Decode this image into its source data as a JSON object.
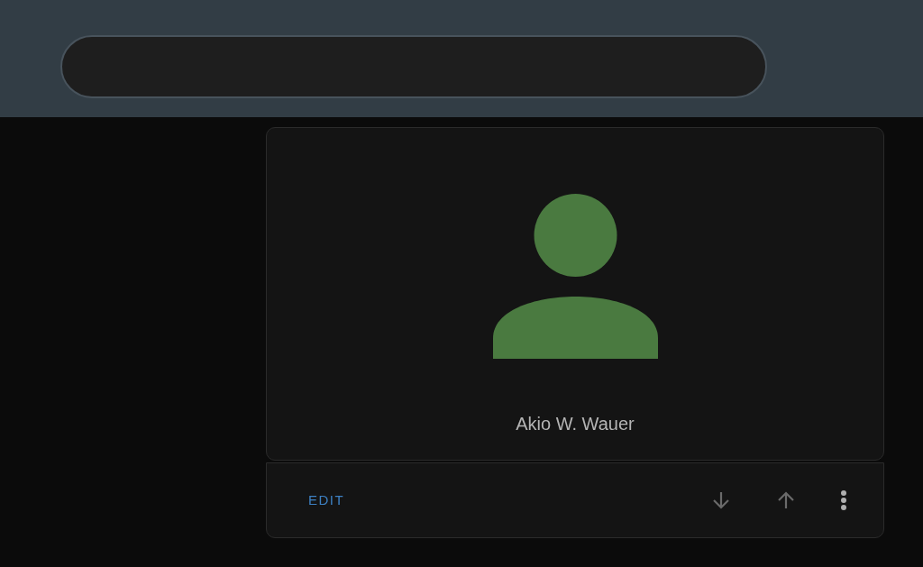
{
  "card": {
    "name": "Akio W. Wauer"
  },
  "actions": {
    "edit_label": "EDIT"
  }
}
